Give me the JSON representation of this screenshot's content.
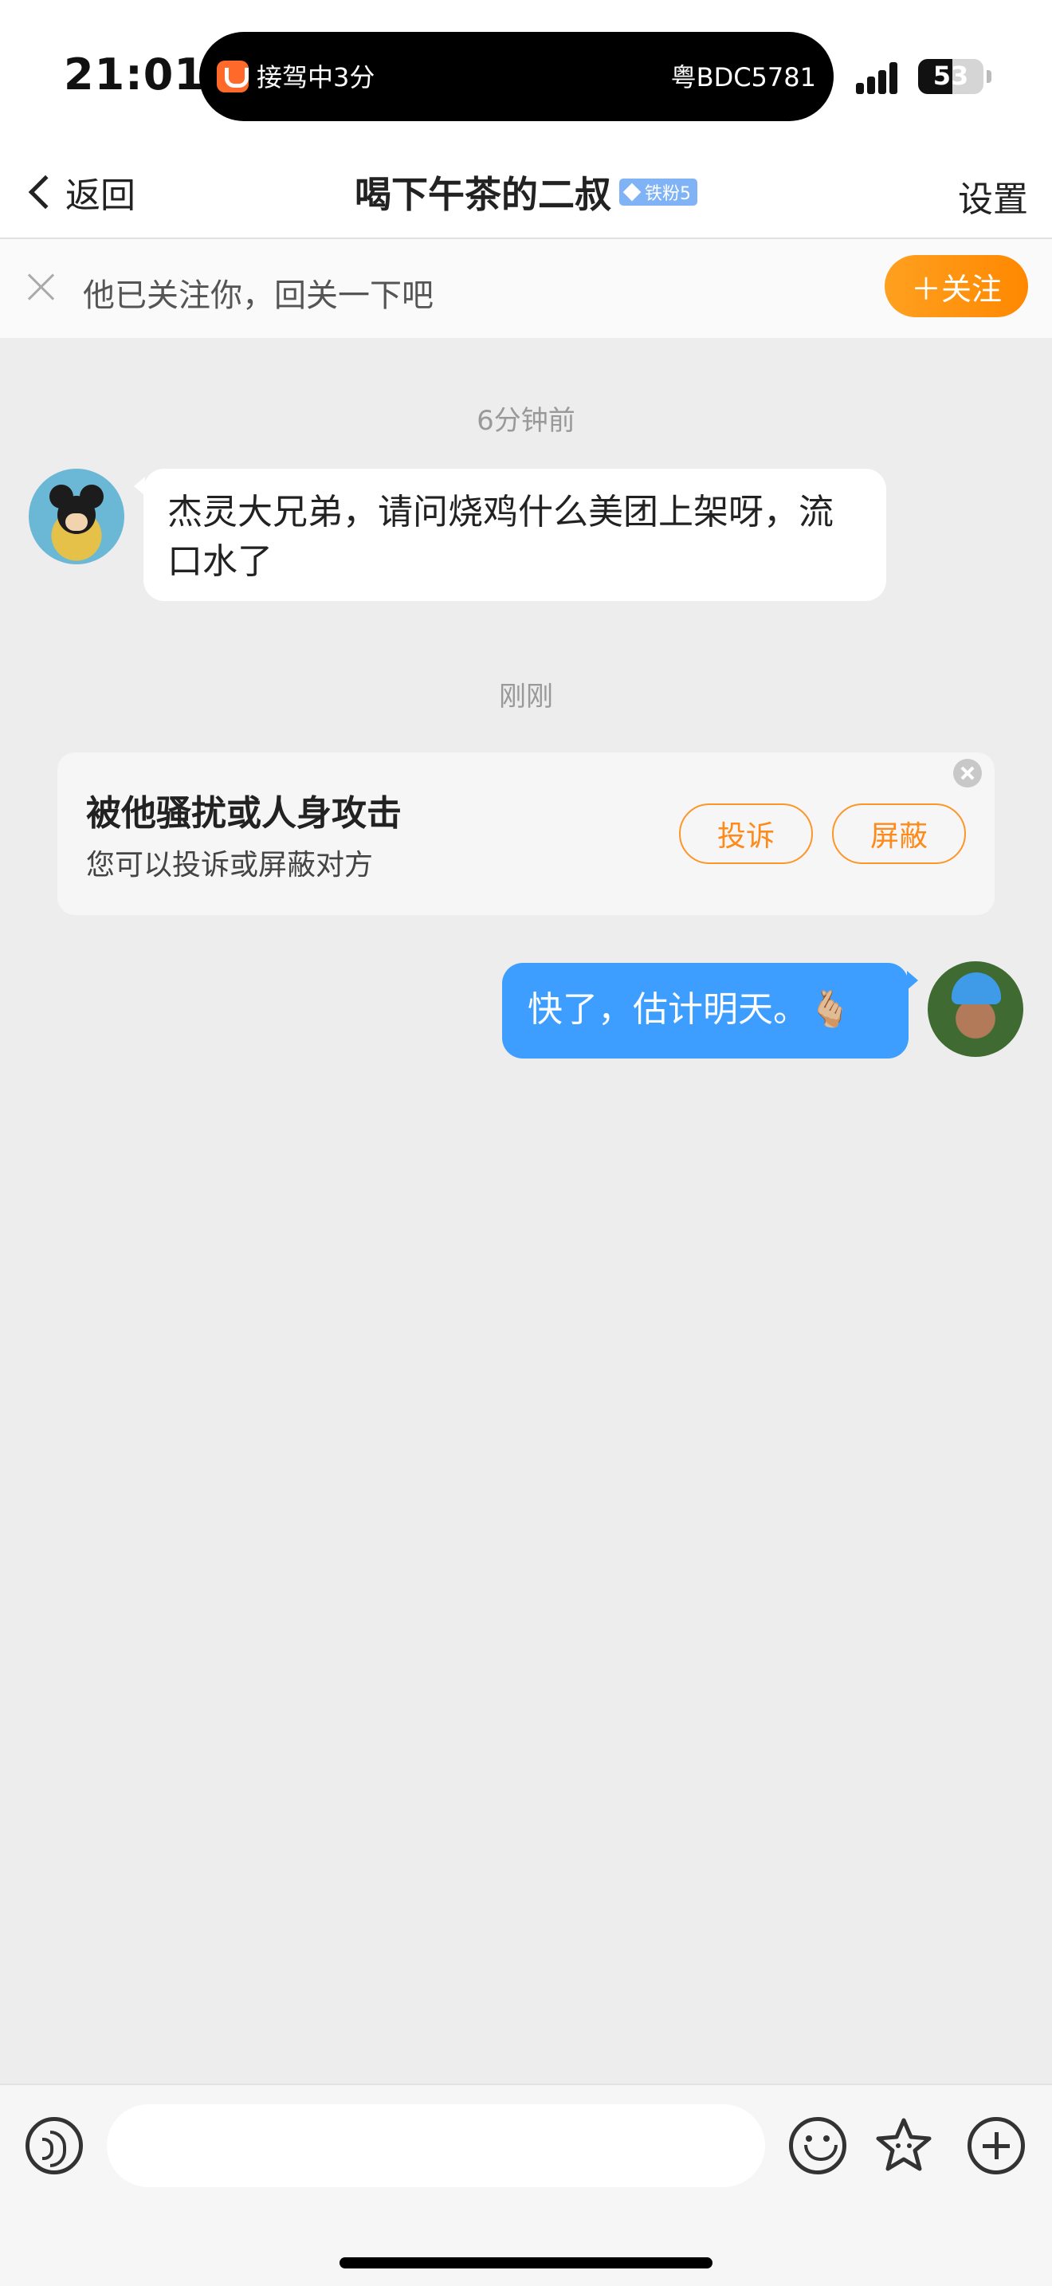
{
  "status_bar": {
    "time": "21:01",
    "island_left": "接驾中3分",
    "island_right": "粤BDC5781",
    "battery": "53",
    "battery_level": 0.53
  },
  "nav": {
    "back_label": "返回",
    "title": "喝下午茶的二叔",
    "badge": "铁粉5",
    "settings_label": "设置"
  },
  "follow_banner": {
    "text": "他已关注你，回关一下吧",
    "button_label": "＋关注"
  },
  "messages": [
    {
      "timestamp": "6分钟前",
      "text": "杰灵大兄弟，请问烧鸡什么美团上架呀，流口水了"
    },
    {
      "timestamp": "刚刚",
      "text": "快了，估计明天。🫰🏼"
    }
  ],
  "harass_card": {
    "title": "被他骚扰或人身攻击",
    "subtitle": "您可以投诉或屏蔽对方",
    "complain_label": "投诉",
    "block_label": "屏蔽"
  },
  "composer": {
    "placeholder": ""
  },
  "colors": {
    "accent_orange": "#ff8a1a",
    "outgoing_bubble": "#3d9eff",
    "background": "#ededed"
  }
}
